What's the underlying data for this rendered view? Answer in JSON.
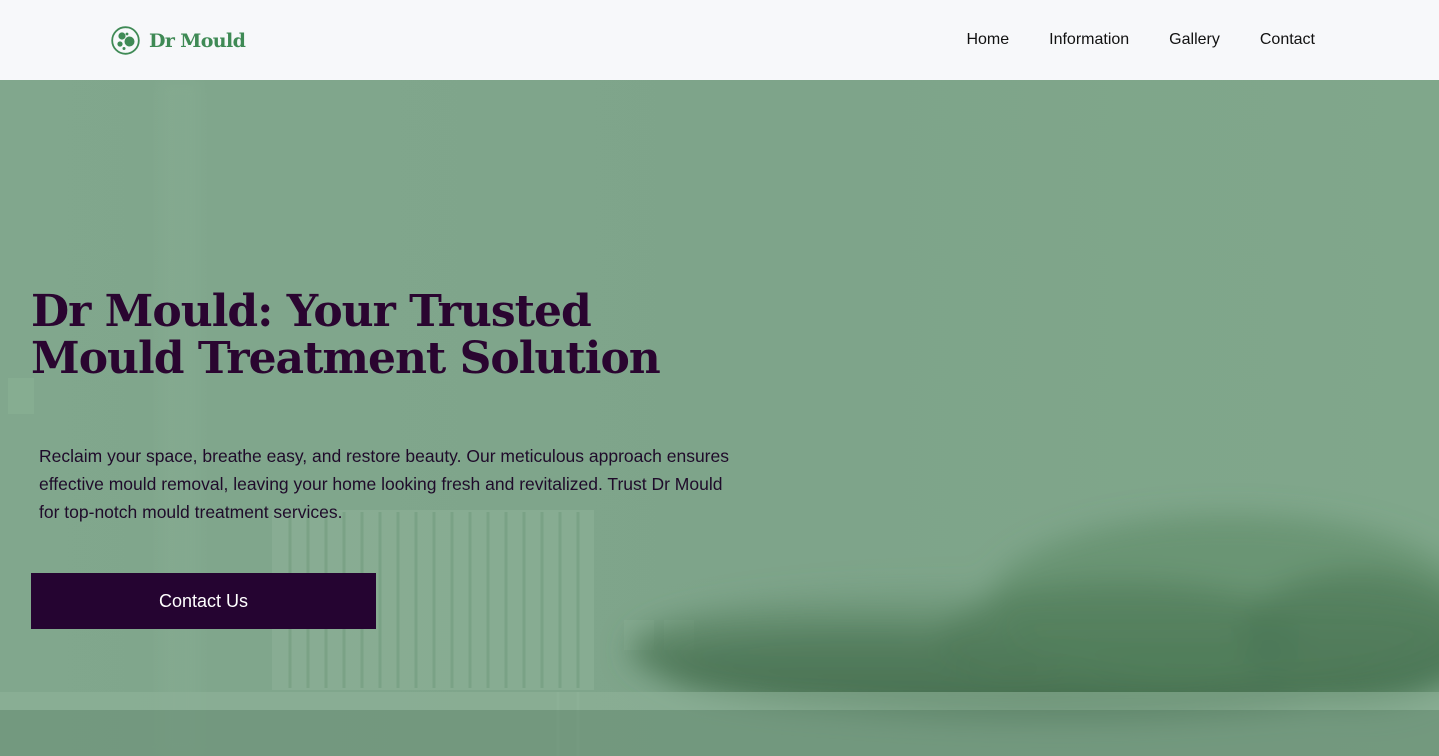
{
  "brand": {
    "name": "Dr Mould",
    "color": "#3f8a55"
  },
  "nav": {
    "items": [
      {
        "label": "Home"
      },
      {
        "label": "Information"
      },
      {
        "label": "Gallery"
      },
      {
        "label": "Contact"
      }
    ]
  },
  "hero": {
    "title": "Dr Mould: Your Trusted Mould Treatment Solution",
    "description": "Reclaim your space, breathe easy, and restore beauty. Our meticulous approach ensures effective mould removal, leaving your home looking fresh and revitalized. Trust Dr Mould for top-notch mould treatment services.",
    "cta_label": "Contact Us",
    "overlay_color": "#7fa68c",
    "title_color": "#2a0530",
    "button_color": "#250431"
  }
}
